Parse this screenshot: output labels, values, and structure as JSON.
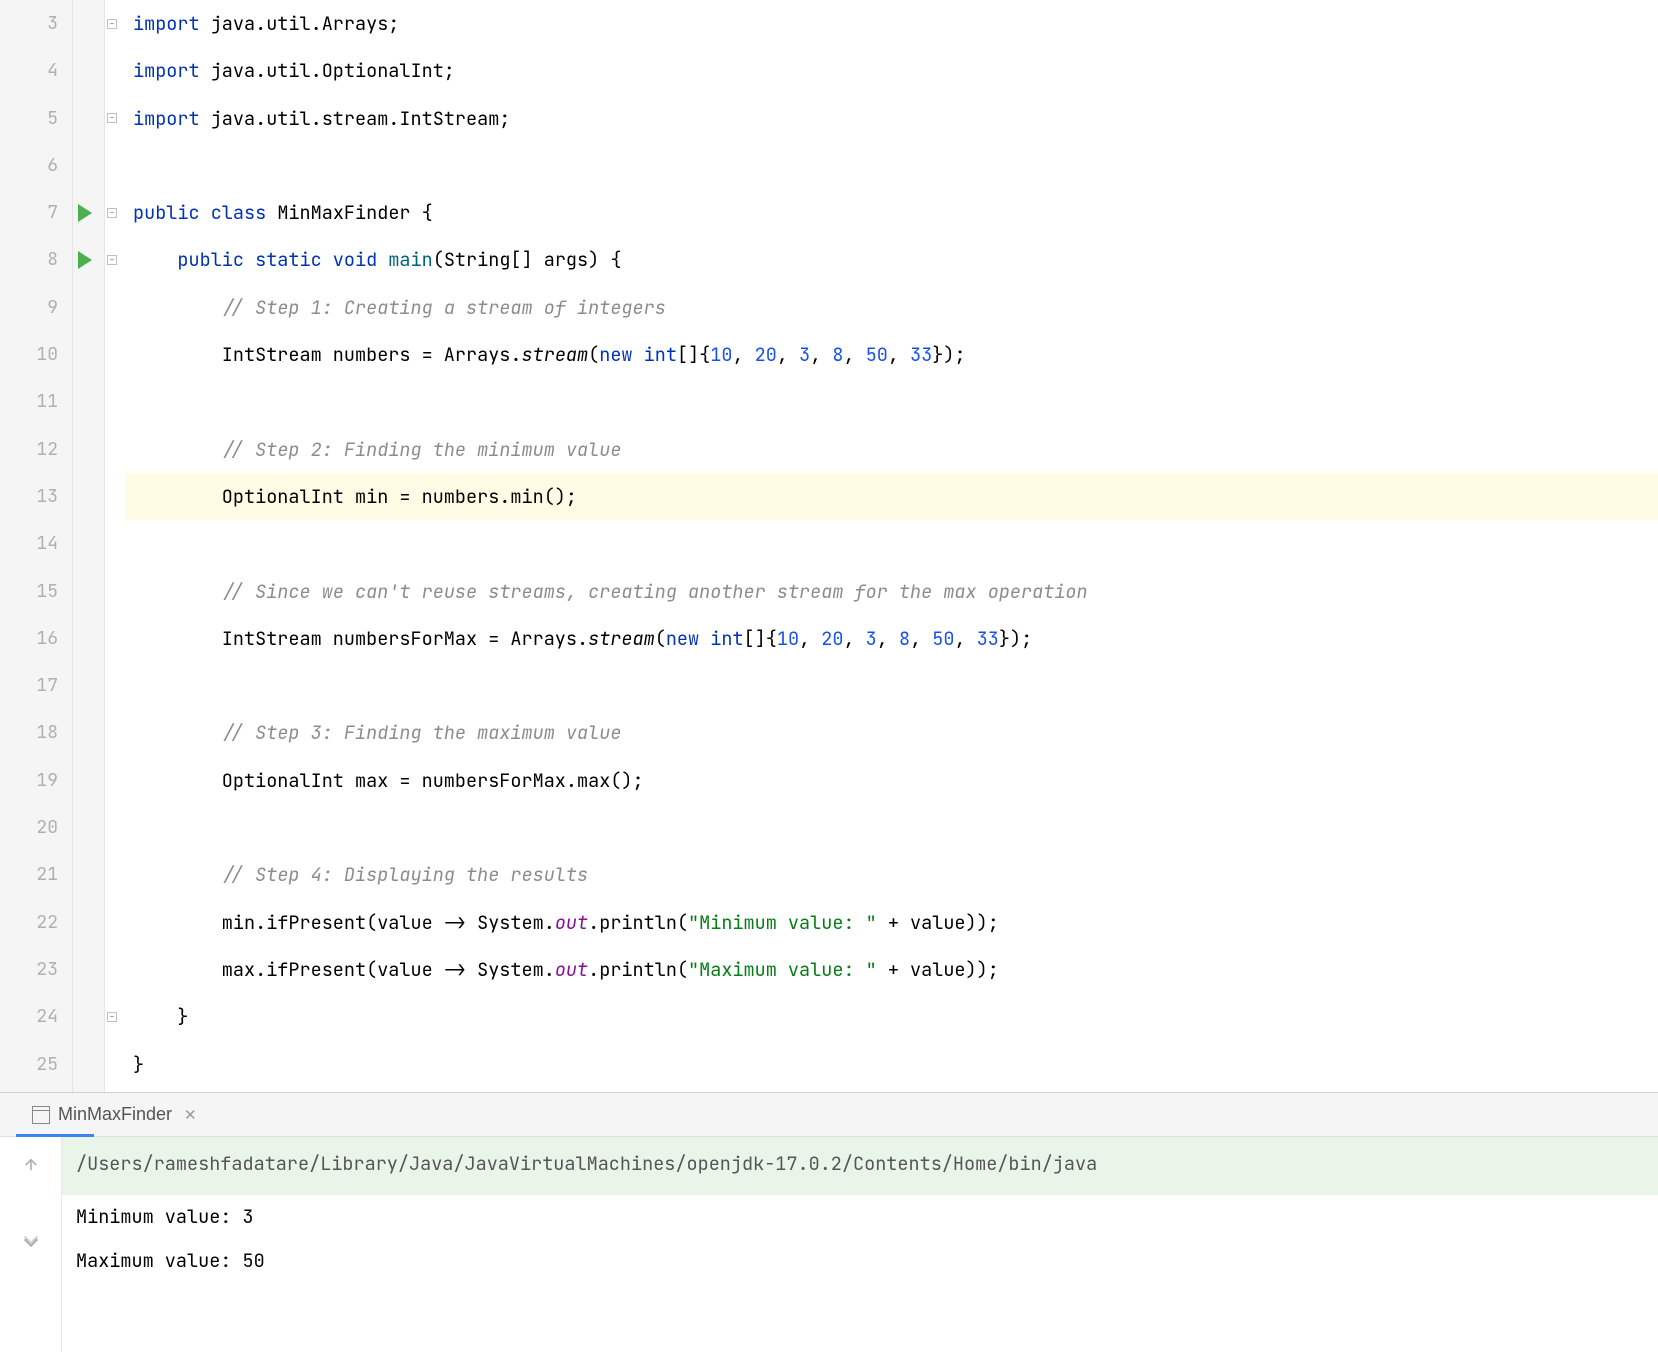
{
  "gutter": {
    "start": 3,
    "end": 25
  },
  "runIcons": [
    7,
    8
  ],
  "highlightLine": 13,
  "code": {
    "3": [
      {
        "t": "kw",
        "v": "import "
      },
      {
        "t": "tok",
        "v": "java.util.Arrays;"
      }
    ],
    "4": [
      {
        "t": "kw",
        "v": "import "
      },
      {
        "t": "tok",
        "v": "java.util.OptionalInt;"
      }
    ],
    "5": [
      {
        "t": "kw",
        "v": "import "
      },
      {
        "t": "tok",
        "v": "java.util.stream.IntStream;"
      }
    ],
    "6": [],
    "7": [
      {
        "t": "kw",
        "v": "public class "
      },
      {
        "t": "tok",
        "v": "MinMaxFinder {"
      }
    ],
    "8": [
      {
        "t": "tok",
        "v": "    "
      },
      {
        "t": "kw",
        "v": "public static void "
      },
      {
        "t": "fn",
        "v": "main"
      },
      {
        "t": "tok",
        "v": "(String[] args) {"
      }
    ],
    "9": [
      {
        "t": "tok",
        "v": "        "
      },
      {
        "t": "cmt",
        "v": "// Step 1: Creating a stream of integers"
      }
    ],
    "10": [
      {
        "t": "tok",
        "v": "        IntStream numbers = Arrays."
      },
      {
        "t": "static-m",
        "v": "stream"
      },
      {
        "t": "tok",
        "v": "("
      },
      {
        "t": "kw",
        "v": "new int"
      },
      {
        "t": "tok",
        "v": "[]{"
      },
      {
        "t": "num",
        "v": "10"
      },
      {
        "t": "tok",
        "v": ", "
      },
      {
        "t": "num",
        "v": "20"
      },
      {
        "t": "tok",
        "v": ", "
      },
      {
        "t": "num",
        "v": "3"
      },
      {
        "t": "tok",
        "v": ", "
      },
      {
        "t": "num",
        "v": "8"
      },
      {
        "t": "tok",
        "v": ", "
      },
      {
        "t": "num",
        "v": "50"
      },
      {
        "t": "tok",
        "v": ", "
      },
      {
        "t": "num",
        "v": "33"
      },
      {
        "t": "tok",
        "v": "});"
      }
    ],
    "11": [],
    "12": [
      {
        "t": "tok",
        "v": "        "
      },
      {
        "t": "cmt",
        "v": "// Step 2: Finding the minimum value"
      }
    ],
    "13": [
      {
        "t": "tok",
        "v": "        OptionalInt min = numbers.min();"
      }
    ],
    "14": [],
    "15": [
      {
        "t": "tok",
        "v": "        "
      },
      {
        "t": "cmt",
        "v": "// Since we can't reuse streams, creating another stream for the max operation"
      }
    ],
    "16": [
      {
        "t": "tok",
        "v": "        IntStream numbersForMax = Arrays."
      },
      {
        "t": "static-m",
        "v": "stream"
      },
      {
        "t": "tok",
        "v": "("
      },
      {
        "t": "kw",
        "v": "new int"
      },
      {
        "t": "tok",
        "v": "[]{"
      },
      {
        "t": "num",
        "v": "10"
      },
      {
        "t": "tok",
        "v": ", "
      },
      {
        "t": "num",
        "v": "20"
      },
      {
        "t": "tok",
        "v": ", "
      },
      {
        "t": "num",
        "v": "3"
      },
      {
        "t": "tok",
        "v": ", "
      },
      {
        "t": "num",
        "v": "8"
      },
      {
        "t": "tok",
        "v": ", "
      },
      {
        "t": "num",
        "v": "50"
      },
      {
        "t": "tok",
        "v": ", "
      },
      {
        "t": "num",
        "v": "33"
      },
      {
        "t": "tok",
        "v": "});"
      }
    ],
    "17": [],
    "18": [
      {
        "t": "tok",
        "v": "        "
      },
      {
        "t": "cmt",
        "v": "// Step 3: Finding the maximum value"
      }
    ],
    "19": [
      {
        "t": "tok",
        "v": "        OptionalInt max = numbersForMax.max();"
      }
    ],
    "20": [],
    "21": [
      {
        "t": "tok",
        "v": "        "
      },
      {
        "t": "cmt",
        "v": "// Step 4: Displaying the results"
      }
    ],
    "22": [
      {
        "t": "tok",
        "v": "        min.ifPresent(value -> System."
      },
      {
        "t": "field-it",
        "v": "out"
      },
      {
        "t": "tok",
        "v": ".println("
      },
      {
        "t": "str",
        "v": "\"Minimum value: \""
      },
      {
        "t": "tok",
        "v": " + value));"
      }
    ],
    "23": [
      {
        "t": "tok",
        "v": "        max.ifPresent(value -> System."
      },
      {
        "t": "field-it",
        "v": "out"
      },
      {
        "t": "tok",
        "v": ".println("
      },
      {
        "t": "str",
        "v": "\"Maximum value: \""
      },
      {
        "t": "tok",
        "v": " + value));"
      }
    ],
    "24": [
      {
        "t": "tok",
        "v": "    }"
      }
    ],
    "25": [
      {
        "t": "tok",
        "v": "}"
      }
    ]
  },
  "console": {
    "tab": {
      "label": "MinMaxFinder"
    },
    "lines": [
      {
        "type": "cmd",
        "text": "/Users/rameshfadatare/Library/Java/JavaVirtualMachines/openjdk-17.0.2/Contents/Home/bin/java"
      },
      {
        "type": "out",
        "text": "Minimum value: 3"
      },
      {
        "type": "out",
        "text": "Maximum value: 50"
      }
    ]
  }
}
